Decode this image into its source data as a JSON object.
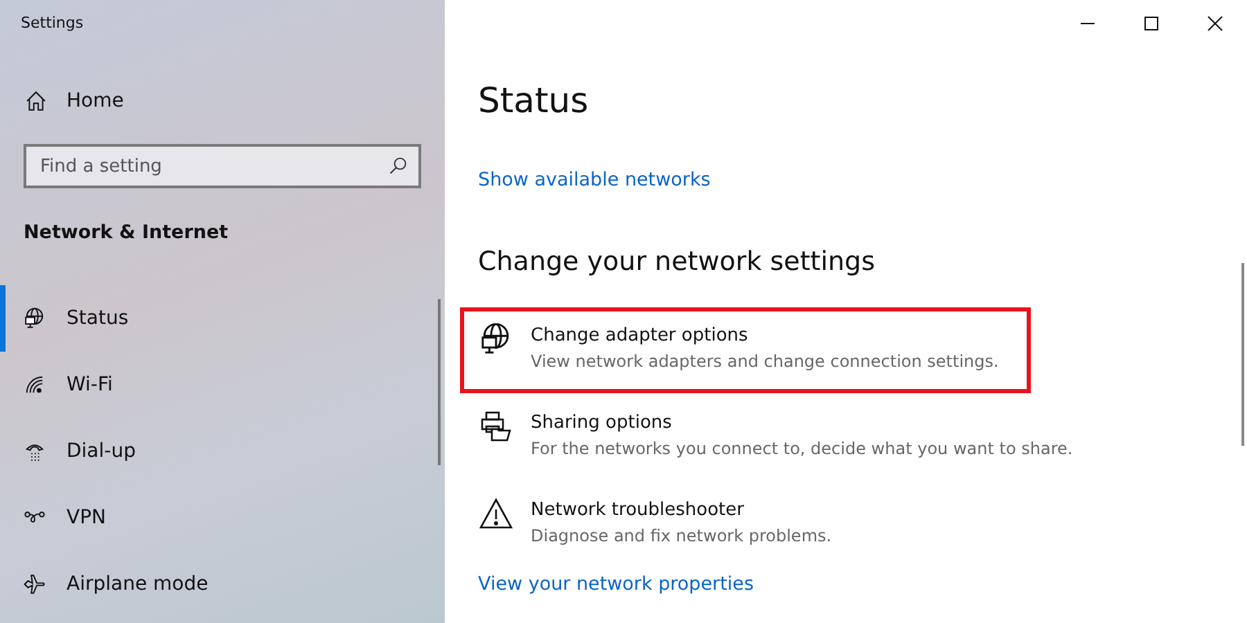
{
  "window": {
    "title": "Settings"
  },
  "sidebar": {
    "home": "Home",
    "search": {
      "placeholder": "Find a setting"
    },
    "section": "Network & Internet",
    "items": [
      {
        "label": "Status",
        "selected": true
      },
      {
        "label": "Wi-Fi",
        "selected": false
      },
      {
        "label": "Dial-up",
        "selected": false
      },
      {
        "label": "VPN",
        "selected": false
      },
      {
        "label": "Airplane mode",
        "selected": false
      }
    ]
  },
  "main": {
    "title": "Status",
    "top_link": "Show available networks",
    "heading": "Change your network settings",
    "options": [
      {
        "title": "Change adapter options",
        "description": "View network adapters and change connection settings.",
        "highlighted": true
      },
      {
        "title": "Sharing options",
        "description": "For the networks you connect to, decide what you want to share.",
        "highlighted": false
      },
      {
        "title": "Network troubleshooter",
        "description": "Diagnose and fix network problems.",
        "highlighted": false
      }
    ],
    "bottom_link": "View your network properties"
  }
}
